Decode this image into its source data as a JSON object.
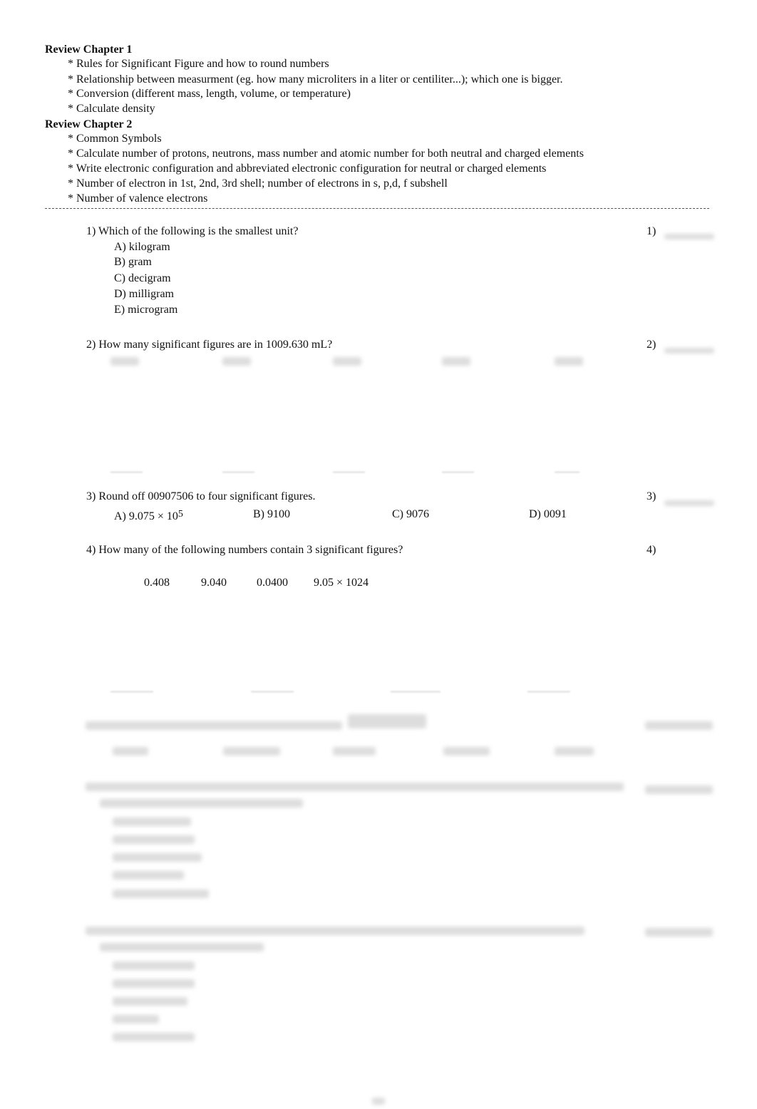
{
  "review1": {
    "title": "Review Chapter 1",
    "items": [
      "* Rules for Significant Figure and how to round numbers",
      "* Relationship between measurment (eg. how many microliters in a liter or centiliter...); which one is bigger.",
      "* Conversion (different mass, length, volume, or temperature)",
      "* Calculate density"
    ]
  },
  "review2": {
    "title": "Review Chapter 2",
    "items": [
      "* Common Symbols",
      "* Calculate number of protons, neutrons, mass number and atomic number for both neutral and charged elements",
      "* Write electronic configuration and abbreviated electronic configuration for neutral or charged elements",
      "* Number of electron in 1st, 2nd, 3rd shell; number of electrons in s, p,d, f subshell",
      "* Number of valence electrons"
    ]
  },
  "q1": {
    "text": "1) Which of the following is the smallest unit?",
    "num": "1)",
    "options": [
      "A) kilogram",
      "B) gram",
      "C) decigram",
      "D) milligram",
      "E) microgram"
    ]
  },
  "q2": {
    "text": "2) How many significant figures are in 1009.630 mL?",
    "num": "2)"
  },
  "q3": {
    "text": "3) Round off 00907506 to four significant figures.",
    "num": "3)",
    "optA": "A) 9.075 × 10",
    "optA_exp": "5",
    "optB": "B) 9100",
    "optC": "C) 9076",
    "optD": "D) 0091"
  },
  "q4": {
    "text": "4) How many of the following numbers contain 3 significant figures?",
    "num": "4)",
    "numbers": [
      "0.408",
      "9.040",
      "0.0400",
      "9.05 × 10"
    ],
    "exp": "24"
  }
}
